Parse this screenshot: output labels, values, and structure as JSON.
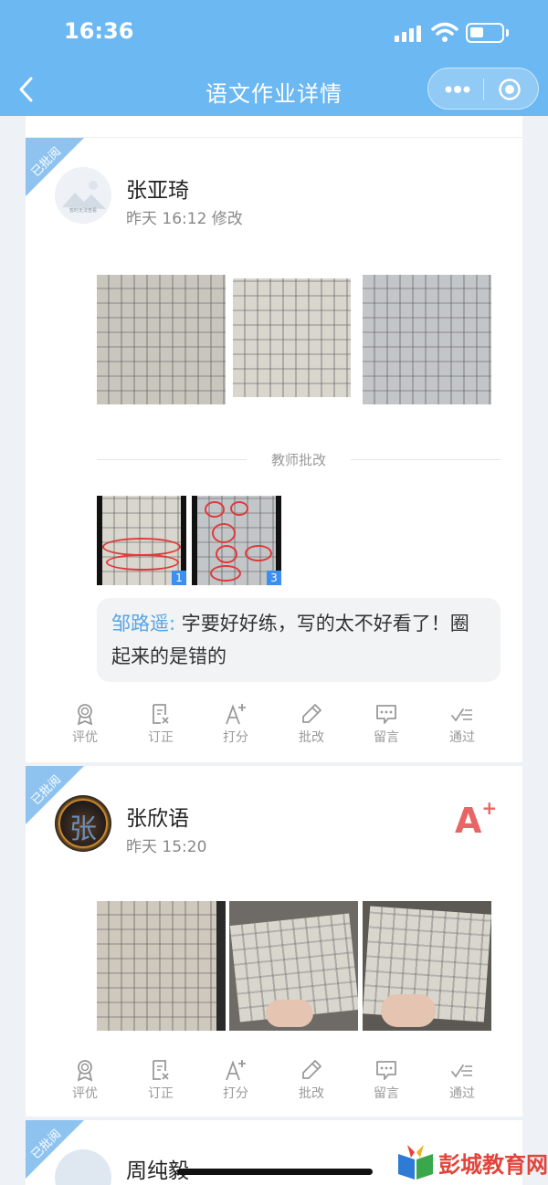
{
  "status": {
    "time": "16:36"
  },
  "nav": {
    "title": "语文作业详情"
  },
  "submissions": [
    {
      "ribbon": "已批阅",
      "name": "张亚琦",
      "time": "昨天 16:12 修改",
      "avatar_text": "暂时无法查看",
      "teacher_section_label": "教师批改",
      "corrected_images": [
        "1",
        "3"
      ],
      "comment_author": "邹路遥:",
      "comment_text": "字要好好练，写的太不好看了！圈起来的是错的"
    },
    {
      "ribbon": "已批阅",
      "name": "张欣语",
      "time": "昨天 15:20",
      "avatar_text": "张",
      "grade": "A",
      "grade_suffix": "+"
    },
    {
      "ribbon": "已批阅",
      "name": "周纯毅"
    }
  ],
  "actions": [
    "评优",
    "订正",
    "打分",
    "批改",
    "留言",
    "通过"
  ],
  "watermark": "彭城教育网",
  "colors": {
    "nav": "#6cb8f2",
    "accent": "#5aa5e3",
    "grade": "#e86565"
  }
}
